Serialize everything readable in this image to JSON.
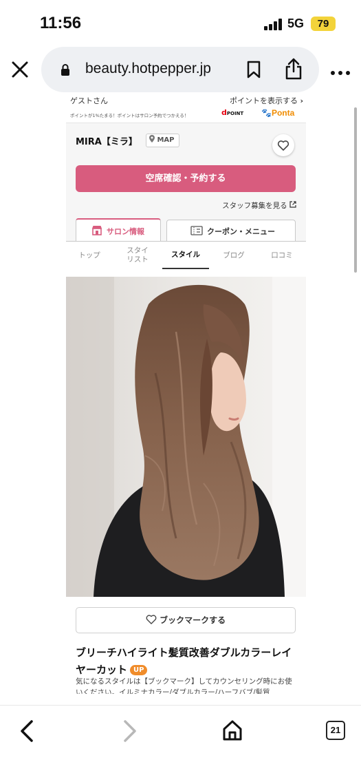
{
  "status_bar": {
    "time": "11:56",
    "network": "5G",
    "battery": "79"
  },
  "browser": {
    "url": "beauty.hotpepper.jp",
    "icons": [
      "close-icon",
      "lock-icon",
      "bookmark-icon",
      "share-icon",
      "more-icon"
    ]
  },
  "points_bar": {
    "guest": "ゲストさん",
    "show_points": "ポイントを表示する",
    "note": "ポイントが1%たまる！ポイントはサロン予約でつかえる！",
    "dpoint_logo": "d",
    "dpoint_label": "POINT",
    "ponta_label": "Ponta"
  },
  "salon": {
    "name": "MIRA【ミラ】",
    "map_label": "MAP",
    "reserve_label": "空席確認・予約する",
    "staff_link": "スタッフ募集を見る"
  },
  "tabs": {
    "salon_info": "サロン情報",
    "coupon_menu": "クーポン・メニュー"
  },
  "subnav": [
    {
      "label": "トップ",
      "active": false
    },
    {
      "label": "スタイ\nリスト",
      "active": false
    },
    {
      "label": "スタイル",
      "active": true
    },
    {
      "label": "ブログ",
      "active": false
    },
    {
      "label": "口コミ",
      "active": false
    }
  ],
  "style": {
    "bookmark_label": "ブックマークする",
    "title": "ブリーチハイライト髪質改善ダブルカラーレイヤーカット",
    "up_badge": "UP",
    "description": "気になるスタイルは【ブックマーク】してカウンセリング時にお使いください。イルミナカラー/ダブルカラー/ハーフバブ/髪質"
  },
  "bottom_nav": {
    "tab_count": "21"
  },
  "colors": {
    "accent": "#d85c7e",
    "up_badge": "#f08c2a",
    "dpoint": "#e60012",
    "ponta": "#f08c00"
  }
}
